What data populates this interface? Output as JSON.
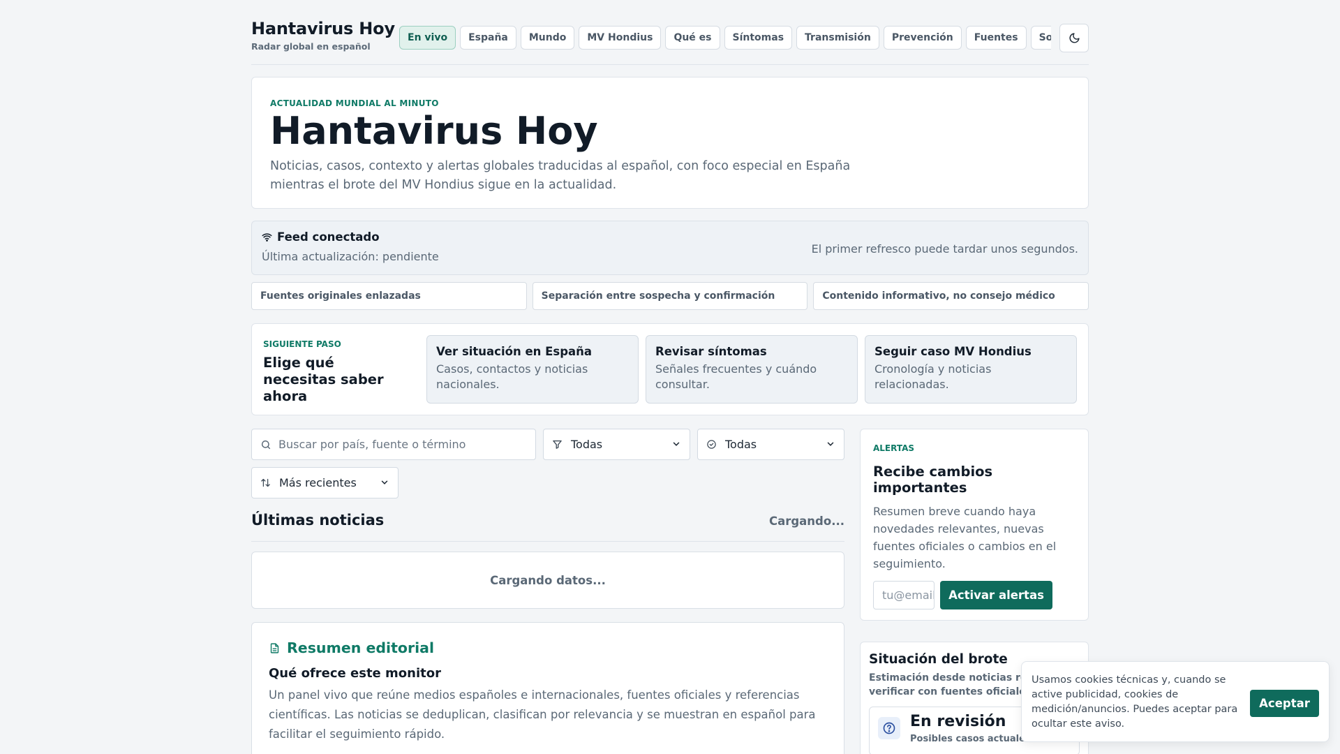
{
  "brand": {
    "title": "Hantavirus Hoy",
    "subtitle": "Radar global en español"
  },
  "nav": {
    "items": [
      "En vivo",
      "España",
      "Mundo",
      "MV Hondius",
      "Qué es",
      "Síntomas",
      "Transmisión",
      "Prevención",
      "Fuentes",
      "Sobre"
    ],
    "active": "En vivo",
    "theme_icon": "moon-icon"
  },
  "hero": {
    "eyebrow": "ACTUALIDAD MUNDIAL AL MINUTO",
    "title": "Hantavirus Hoy",
    "description": "Noticias, casos, contexto y alertas globales traducidas al español, con foco especial en España mientras el brote del MV Hondius sigue en la actualidad."
  },
  "feed": {
    "title": "Feed conectado",
    "last_update": "Última actualización: pendiente",
    "note": "El primer refresco puede tardar unos segundos."
  },
  "trust": [
    "Fuentes originales enlazadas",
    "Separación entre sospecha y confirmación",
    "Contenido informativo, no consejo médico"
  ],
  "next_step": {
    "eyebrow": "SIGUIENTE PASO",
    "title": "Elige qué necesitas saber ahora",
    "cards": [
      {
        "title": "Ver situación en España",
        "desc": "Casos, contactos y noticias nacionales."
      },
      {
        "title": "Revisar síntomas",
        "desc": "Señales frecuentes y cuándo consultar."
      },
      {
        "title": "Seguir caso MV Hondius",
        "desc": "Cronología y noticias relacionadas."
      }
    ]
  },
  "filters": {
    "search_placeholder": "Buscar por país, fuente o término",
    "region_value": "Todas",
    "status_value": "Todas",
    "sort_value": "Más recientes"
  },
  "news": {
    "title": "Últimas noticias",
    "status": "Cargando...",
    "loading": "Cargando datos..."
  },
  "editorial": {
    "title": "Resumen editorial",
    "subtitle": "Qué ofrece este monitor",
    "text": "Un panel vivo que reúne medios españoles e internacionales, fuentes oficiales y referencias científicas. Las noticias se deduplican, clasifican por relevancia y se muestran en español para facilitar el seguimiento rápido."
  },
  "alerts": {
    "eyebrow": "ALERTAS",
    "title": "Recibe cambios importantes",
    "description": "Resumen breve cuando haya novedades relevantes, nuevas fuentes oficiales o cambios en el seguimiento.",
    "email_placeholder": "tu@email.com",
    "button": "Activar alertas"
  },
  "outbreak": {
    "title": "Situación del brote",
    "subtitle": "Estimación desde noticias recientes; verificar con fuentes oficiales.",
    "status": "En revisión",
    "status_sub": "Posibles casos actuales"
  },
  "cookie": {
    "text": "Usamos cookies técnicas y, cuando se active publicidad, cookies de medición/anuncios. Puedes aceptar para ocultar este aviso.",
    "button": "Aceptar"
  },
  "colors": {
    "accent": "#0f6b5c",
    "accent_text": "#0f7a66",
    "active_nav_bg": "#e1f1ec"
  }
}
